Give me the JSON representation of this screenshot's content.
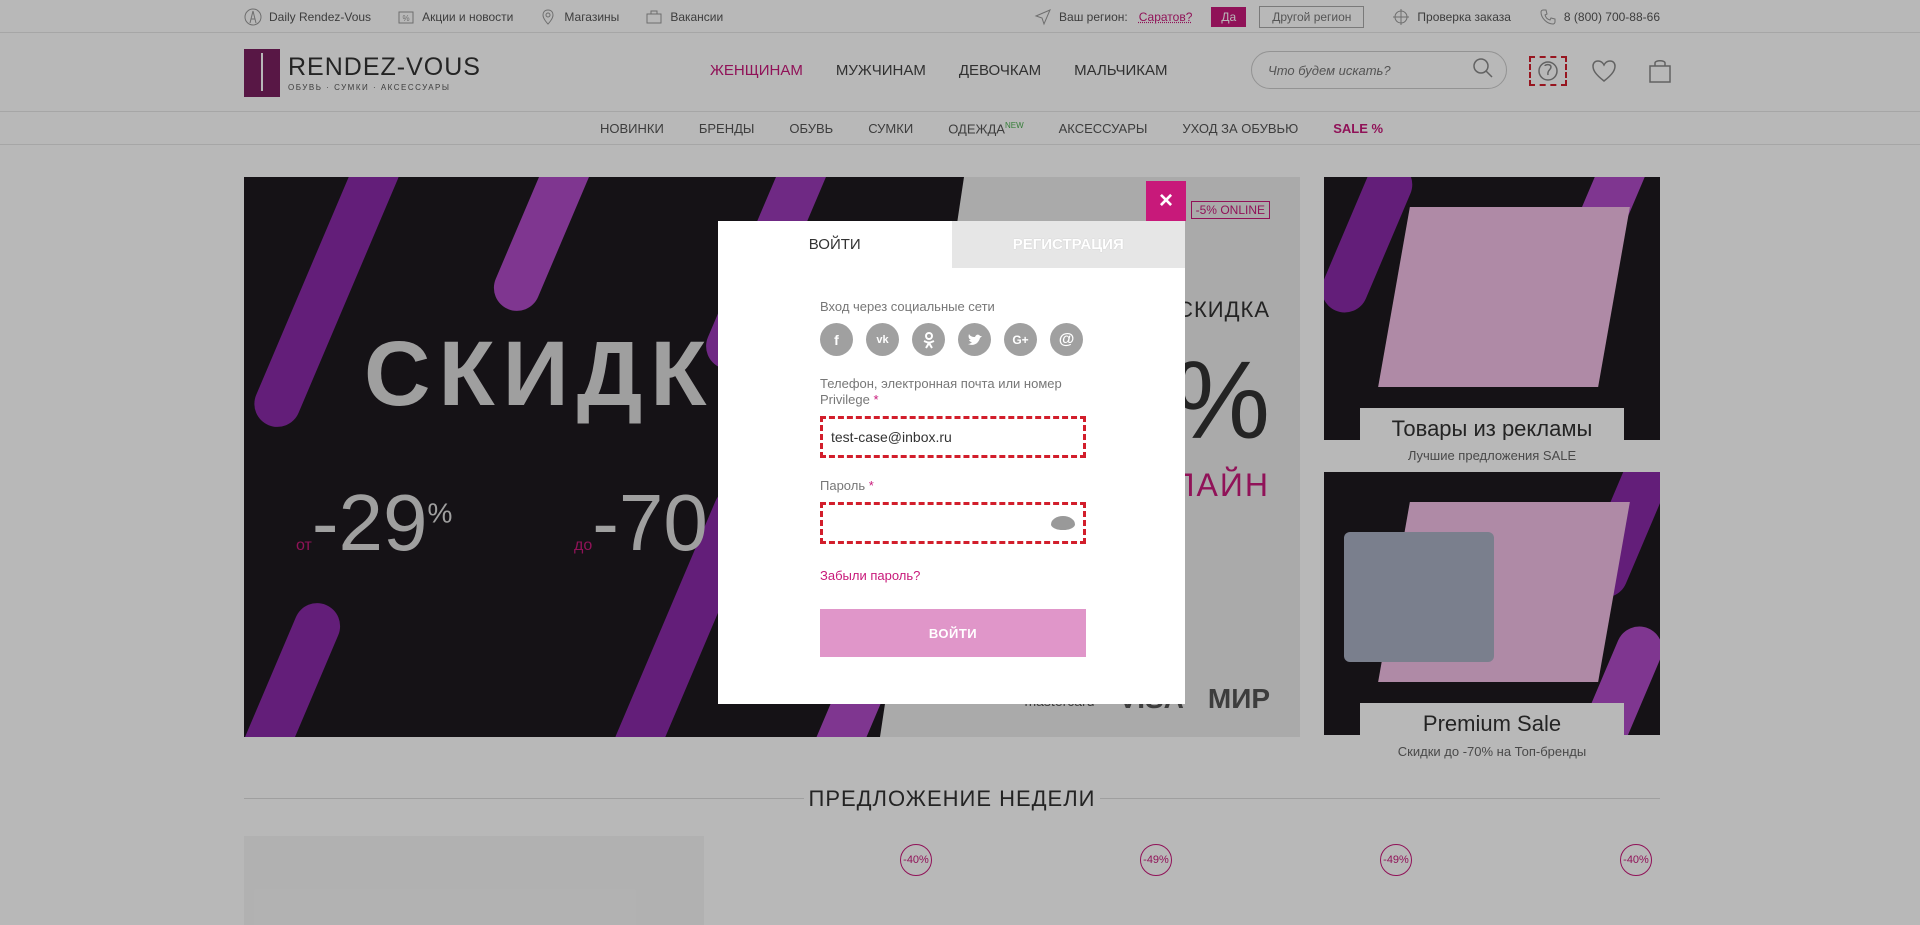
{
  "topbar": {
    "left": [
      {
        "label": "Daily Rendez-Vous",
        "icon": "eiffel-icon"
      },
      {
        "label": "Акции и новости",
        "icon": "percent-tag-icon"
      },
      {
        "label": "Магазины",
        "icon": "map-pin-icon"
      },
      {
        "label": "Вакансии",
        "icon": "briefcase-icon"
      }
    ],
    "region_label": "Ваш регион:",
    "region_value": "Саратов?",
    "yes_label": "Да",
    "other_region_label": "Другой регион",
    "order_check_label": "Проверка заказа",
    "phone": "8 (800) 700-88-66"
  },
  "header": {
    "logo_name": "RENDEZ-VOUS",
    "logo_sub": "ОБУВЬ · СУМКИ · АКСЕССУАРЫ",
    "nav": [
      "ЖЕНЩИНАМ",
      "МУЖЧИНАМ",
      "ДЕВОЧКАМ",
      "МАЛЬЧИКАМ"
    ],
    "search_placeholder": "Что будем искать?"
  },
  "subnav": {
    "items": [
      "НОВИНКИ",
      "БРЕНДЫ",
      "ОБУВЬ",
      "СУМКИ",
      "ОДЕЖДА",
      "АКСЕССУАРЫ",
      "УХОД ЗА ОБУВЬЮ",
      "SALE %"
    ],
    "new_badge": "NEW"
  },
  "hero": {
    "title": "СКИДКИ",
    "from": "от",
    "discount1": "-29",
    "pct": "%",
    "to": "до",
    "discount2": "-70",
    "online_badge": "-5% ONLINE",
    "skidka": "СКИДКА",
    "big_pct": "%",
    "lain": "ЛАЙН",
    "cards": [
      "mastercard",
      "VISA",
      "МИР"
    ]
  },
  "side_banners": [
    {
      "title": "Товары из рекламы",
      "subtitle": "Лучшие предложения SALE"
    },
    {
      "title": "Premium Sale",
      "subtitle": "Скидки до -70% на Топ-бренды"
    }
  ],
  "week": {
    "title": "ПРЕДЛОЖЕНИЕ НЕДЕЛИ",
    "badges": [
      "-40%",
      "-49%",
      "-49%",
      "-40%"
    ]
  },
  "modal": {
    "close": "×",
    "tab_login": "ВОЙТИ",
    "tab_register": "РЕГИСТРАЦИЯ",
    "social_label": "Вход через социальные сети",
    "socials": [
      "f",
      "vk",
      "ok",
      "tw",
      "G+",
      "@"
    ],
    "login_label": "Телефон, электронная почта или номер Privilege",
    "login_value": "test-case@inbox.ru",
    "password_label": "Пароль",
    "password_value": "",
    "required_mark": "*",
    "forgot": "Забыли пароль?",
    "submit": "ВОЙТИ"
  },
  "colors": {
    "accent": "#c8197a",
    "submit": "#e096c9",
    "focus": "#d21e2b"
  }
}
